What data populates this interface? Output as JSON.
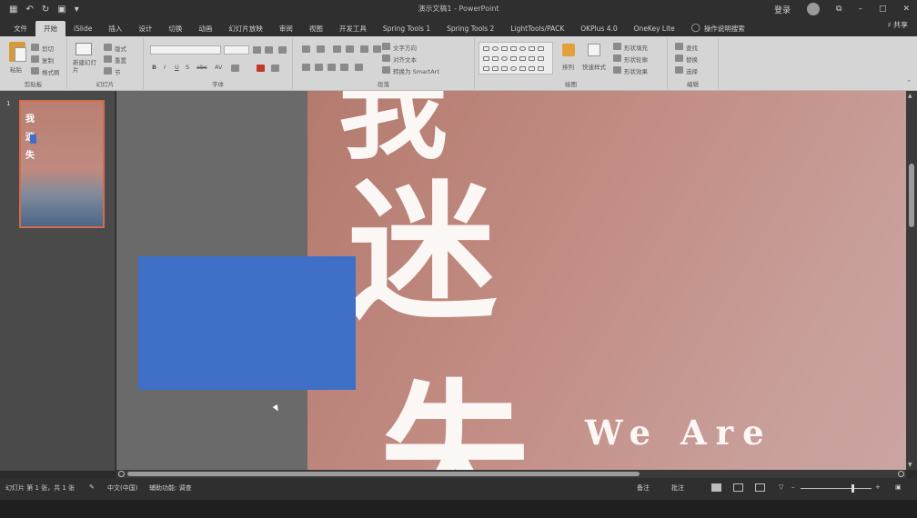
{
  "window": {
    "title": "演示文稿1 - PowerPoint"
  },
  "qat": {
    "save_icon": "save-icon",
    "undo_icon": "undo-icon",
    "redo_icon": "redo-icon"
  },
  "titlebar_right": {
    "user": "登录",
    "restore": "⧉",
    "minimize": "–",
    "maximize": "□",
    "close": "✕"
  },
  "tabs": [
    {
      "label": "文件"
    },
    {
      "label": "开始",
      "active": true
    },
    {
      "label": "iSlide"
    },
    {
      "label": "插入"
    },
    {
      "label": "设计"
    },
    {
      "label": "切换"
    },
    {
      "label": "动画"
    },
    {
      "label": "幻灯片放映"
    },
    {
      "label": "审阅"
    },
    {
      "label": "视图"
    },
    {
      "label": "开发工具"
    },
    {
      "label": "Spring Tools 1"
    },
    {
      "label": "Spring Tools 2"
    },
    {
      "label": "LightTools/PACK"
    },
    {
      "label": "OKPlus 4.0"
    },
    {
      "label": "OneKey Lite"
    },
    {
      "label": "操作说明搜索"
    }
  ],
  "share": {
    "label": "共享"
  },
  "ribbon": {
    "clipboard": {
      "label": "剪贴板",
      "paste": "粘贴",
      "cut": "剪切",
      "copy": "复制",
      "painter": "格式刷"
    },
    "slides": {
      "label": "幻灯片",
      "new_slide": "新建幻灯片",
      "layout": "版式",
      "reset": "重置",
      "section": "节"
    },
    "font": {
      "label": "字体"
    },
    "paragraph": {
      "label": "段落",
      "text_dir": "文字方向",
      "align": "对齐文本",
      "smartart": "转换为 SmartArt"
    },
    "drawing": {
      "label": "绘图",
      "arrange": "排列",
      "quick_styles": "快速样式",
      "fill": "形状填充",
      "outline": "形状轮廓",
      "effects": "形状效果"
    },
    "editing": {
      "label": "编辑",
      "find": "查找",
      "replace": "替换",
      "select": "选择"
    }
  },
  "thumbnails": [
    {
      "number": "1"
    }
  ],
  "slide": {
    "chars": [
      "我",
      "迷",
      "失"
    ],
    "we_are": "We Are"
  },
  "status": {
    "slide_info": "幻灯片 第 1 张，共 1 张",
    "language": "中文(中国)",
    "accessibility": "辅助功能: 调查",
    "notes": "备注",
    "comments": "批注"
  },
  "colors": {
    "accent_blue": "#3f6fc6",
    "thumb_border": "#d46b4d",
    "ribbon_bg": "#d5d5d5"
  }
}
